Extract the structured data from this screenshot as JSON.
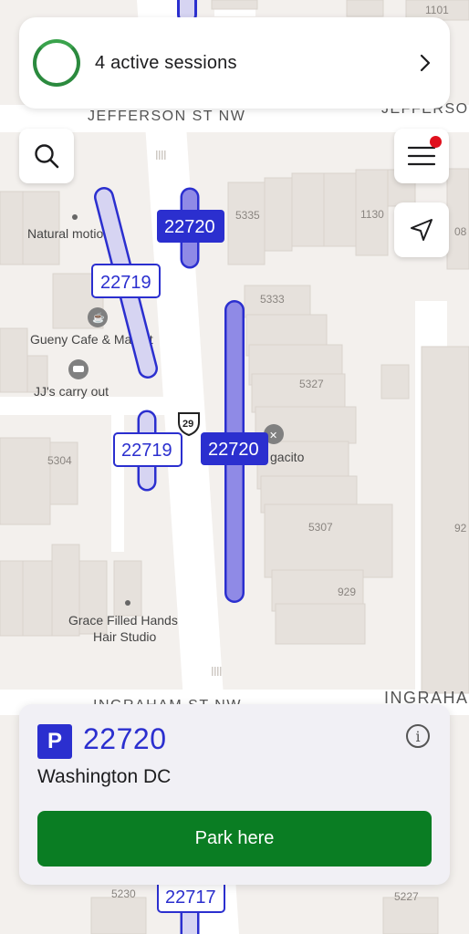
{
  "header": {
    "sessions_label": "4 active sessions"
  },
  "map": {
    "streets": {
      "jefferson": "JEFFERSON ST NW",
      "jefferson_right": "JEFFERSO",
      "ingraham": "INGRAHAM ST NW",
      "ingraham_right": "INGRAHA"
    },
    "places": {
      "natural_motion": "Natural motion",
      "gueny_cafe": "Gueny Cafe & Market",
      "jjs": "JJ's carry out",
      "grace_line1": "Grace Filled Hands",
      "grace_line2": "Hair Studio",
      "restaurant": "gacito"
    },
    "route_shield": "29",
    "address_numbers": {
      "n1101": "1101",
      "n5335": "5335",
      "n1130": "1130",
      "n08": "08",
      "n5333": "5333",
      "n5327": "5327",
      "n5304": "5304",
      "n5307": "5307",
      "n92": "92",
      "n929": "929",
      "n5230": "5230",
      "n5227": "5227"
    },
    "zones": {
      "z22720_top": "22720",
      "z22719_top": "22719",
      "z22719_bottom": "22719",
      "z22720_selected": "22720",
      "z22717": "22717"
    }
  },
  "info_card": {
    "badge": "P",
    "zone_number": "22720",
    "city": "Washington DC",
    "info_glyph": "i",
    "park_button_label": "Park here"
  },
  "colors": {
    "accent": "#2b2fcf",
    "park_green": "#0a7d23",
    "ring_green": "#2b8a3e",
    "notification": "#e0101d",
    "zone_fill": "#d6d4f2",
    "zone_selected_fill": "#8f8ae6"
  },
  "icons": {
    "search": "search-icon",
    "menu": "menu-icon",
    "locate": "location-arrow-icon",
    "info": "info-icon",
    "chevron": "chevron-right-icon"
  }
}
